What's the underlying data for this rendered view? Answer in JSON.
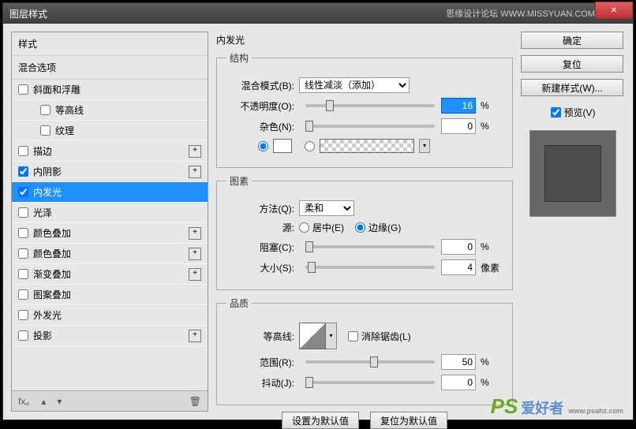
{
  "window": {
    "title": "图层样式",
    "forum_text": "思缘设计论坛  WWW.MISSYUAN.COM",
    "close": "×"
  },
  "left": {
    "styles_header": "样式",
    "blend_header": "混合选项",
    "items": [
      {
        "label": "斜面和浮雕",
        "checked": false,
        "plus": false,
        "sub": false
      },
      {
        "label": "等高线",
        "checked": false,
        "plus": false,
        "sub": true
      },
      {
        "label": "纹理",
        "checked": false,
        "plus": false,
        "sub": true
      },
      {
        "label": "描边",
        "checked": false,
        "plus": true,
        "sub": false
      },
      {
        "label": "内阴影",
        "checked": true,
        "plus": true,
        "sub": false
      },
      {
        "label": "内发光",
        "checked": true,
        "plus": false,
        "sub": false,
        "selected": true
      },
      {
        "label": "光泽",
        "checked": false,
        "plus": false,
        "sub": false
      },
      {
        "label": "颜色叠加",
        "checked": false,
        "plus": true,
        "sub": false
      },
      {
        "label": "颜色叠加",
        "checked": false,
        "plus": true,
        "sub": false
      },
      {
        "label": "渐变叠加",
        "checked": false,
        "plus": true,
        "sub": false
      },
      {
        "label": "图案叠加",
        "checked": false,
        "plus": false,
        "sub": false
      },
      {
        "label": "外发光",
        "checked": false,
        "plus": false,
        "sub": false
      },
      {
        "label": "投影",
        "checked": false,
        "plus": true,
        "sub": false
      }
    ],
    "footer": {
      "fx": "fx｡",
      "up": "▴",
      "down": "▾",
      "trash": "🗑"
    }
  },
  "center": {
    "title": "内发光",
    "structure": {
      "legend": "结构",
      "blend_mode_label": "混合模式(B):",
      "blend_mode_value": "线性减淡（添加）",
      "opacity_label": "不透明度(O):",
      "opacity_value": "16",
      "opacity_unit": "%",
      "noise_label": "杂色(N):",
      "noise_value": "0",
      "noise_unit": "%"
    },
    "elements": {
      "legend": "图素",
      "technique_label": "方法(Q):",
      "technique_value": "柔和",
      "source_label": "源:",
      "center_label": "居中(E)",
      "edge_label": "边缘(G)",
      "choke_label": "阻塞(C):",
      "choke_value": "0",
      "choke_unit": "%",
      "size_label": "大小(S):",
      "size_value": "4",
      "size_unit": "像素"
    },
    "quality": {
      "legend": "品质",
      "contour_label": "等高线:",
      "antialias_label": "消除锯齿(L)",
      "range_label": "范围(R):",
      "range_value": "50",
      "range_unit": "%",
      "jitter_label": "抖动(J):",
      "jitter_value": "0",
      "jitter_unit": "%"
    },
    "defaults": {
      "set": "设置为默认值",
      "reset": "复位为默认值"
    }
  },
  "right": {
    "ok": "确定",
    "reset": "复位",
    "new_style": "新建样式(W)...",
    "preview_label": "预览(V)"
  },
  "watermark": {
    "ps": "PS",
    "cn": "爱好者",
    "url": "www.psahz.com"
  }
}
